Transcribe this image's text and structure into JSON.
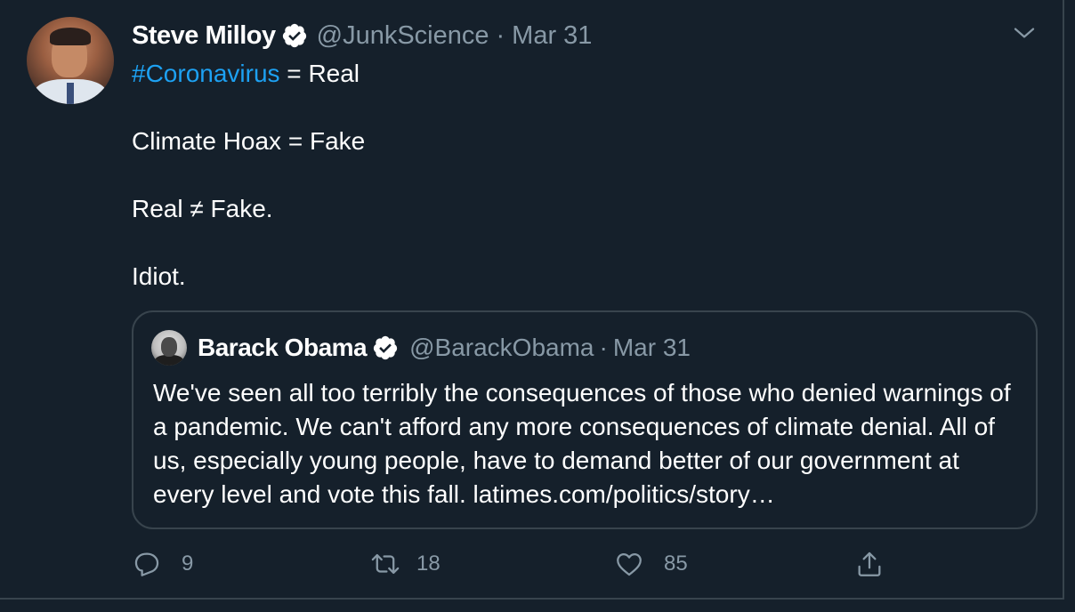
{
  "author": {
    "name": "Steve Milloy",
    "handle": "@JunkScience",
    "separator": "·",
    "date": "Mar 31"
  },
  "tweet": {
    "hashtag": "#Coronavirus",
    "line1_rest": " = Real",
    "line2": "Climate Hoax = Fake",
    "line3": "Real ≠ Fake.",
    "line4": "Idiot."
  },
  "quoted": {
    "name": "Barack Obama",
    "handle": "@BarackObama",
    "separator": "·",
    "date": "Mar 31",
    "text": "We've seen all too terribly the consequences of those who denied warnings of a pandemic. We can't afford any more consequences of climate denial. All of us, especially young people, have to demand better of our government at every level and vote this fall. latimes.com/politics/story…"
  },
  "actions": {
    "reply_count": "9",
    "retweet_count": "18",
    "like_count": "85"
  },
  "icons": {
    "verified": "verified-badge-icon",
    "menu": "chevron-down-icon",
    "reply": "reply-icon",
    "retweet": "retweet-icon",
    "like": "heart-icon",
    "share": "share-icon"
  },
  "colors": {
    "background": "#15202b",
    "accent": "#1da1f2",
    "muted": "#8899a6",
    "border": "#38444d"
  }
}
